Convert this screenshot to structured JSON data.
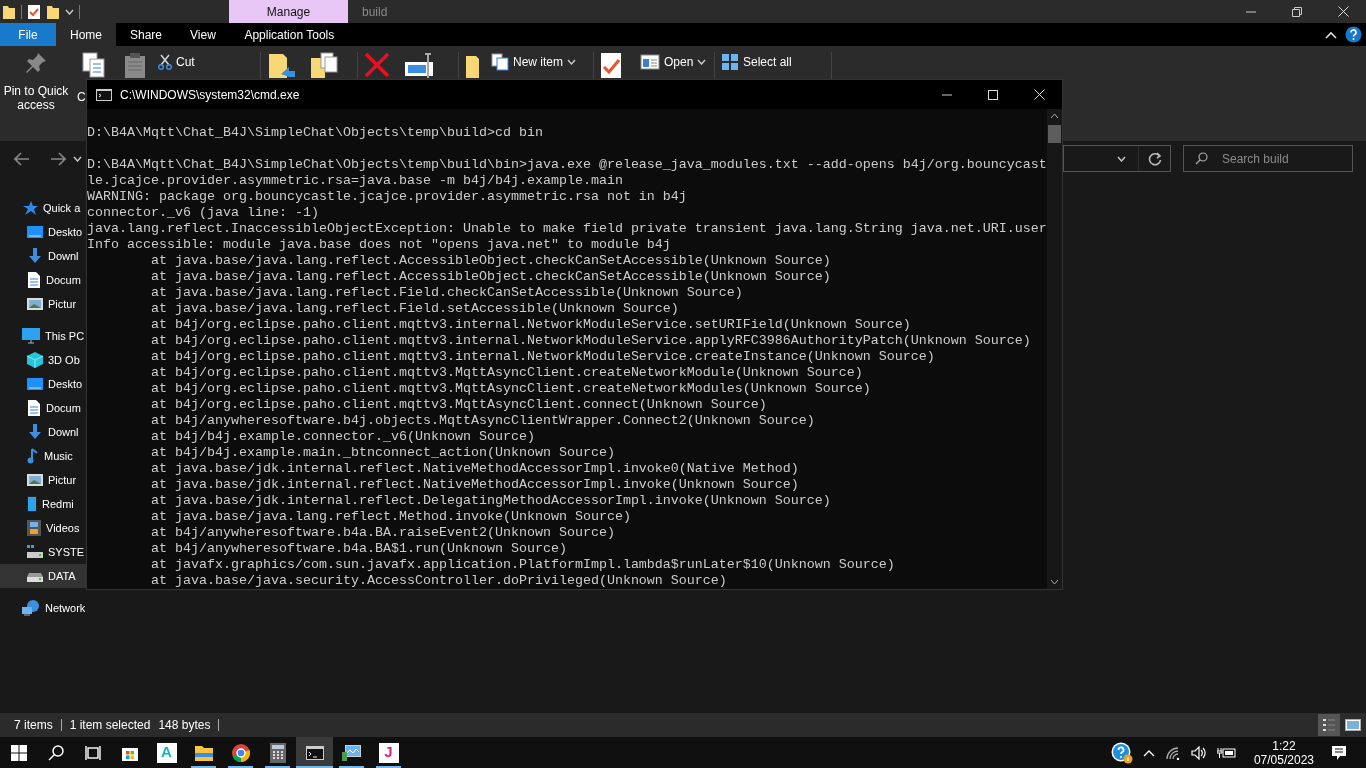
{
  "explorer": {
    "context_tab": "Manage",
    "title": "build",
    "tabs": [
      {
        "label": "File",
        "kind": "file",
        "selected": false
      },
      {
        "label": "Home",
        "kind": "tab",
        "selected": true
      },
      {
        "label": "Share",
        "kind": "tab",
        "selected": false
      },
      {
        "label": "View",
        "kind": "tab",
        "selected": false
      },
      {
        "label": "Application Tools",
        "kind": "context",
        "selected": false
      }
    ],
    "ribbon": [
      {
        "kind": "pin",
        "label": "Pin to Quick access"
      },
      {
        "kind": "copy",
        "label": "C"
      },
      {
        "kind": "paste"
      },
      {
        "kind": "cut",
        "label": "Cut"
      },
      {
        "kind": "separator"
      },
      {
        "kind": "move"
      },
      {
        "kind": "copyto"
      },
      {
        "kind": "separator"
      },
      {
        "kind": "delete"
      },
      {
        "kind": "rename"
      },
      {
        "kind": "separator"
      },
      {
        "kind": "newfolder"
      },
      {
        "kind": "newitem",
        "label": "New item"
      },
      {
        "kind": "separator"
      },
      {
        "kind": "properties"
      },
      {
        "kind": "open",
        "label": "Open"
      },
      {
        "kind": "separator"
      },
      {
        "kind": "selectall",
        "label": "Select all"
      },
      {
        "kind": "separator"
      }
    ],
    "search": {
      "placeholder": "Search build"
    },
    "sidebar": [
      {
        "label": "Quick a",
        "kind": "star",
        "selected": false,
        "children": [
          {
            "label": "Deskto",
            "kind": "desktop",
            "selected": false
          },
          {
            "label": "Downl",
            "kind": "download",
            "selected": false
          },
          {
            "label": "Docum",
            "kind": "document",
            "selected": false
          },
          {
            "label": "Pictur",
            "kind": "picture",
            "selected": false
          }
        ]
      },
      {
        "label": "This PC",
        "kind": "pc",
        "selected": false,
        "children": [
          {
            "label": "3D Ob",
            "kind": "cube",
            "selected": false
          },
          {
            "label": "Deskto",
            "kind": "desktop",
            "selected": false
          },
          {
            "label": "Docum",
            "kind": "document",
            "selected": false
          },
          {
            "label": "Downl",
            "kind": "download",
            "selected": false
          },
          {
            "label": "Music",
            "kind": "music",
            "selected": false
          },
          {
            "label": "Pictur",
            "kind": "picture",
            "selected": false
          },
          {
            "label": "Redmi",
            "kind": "phone",
            "selected": false
          },
          {
            "label": "Videos",
            "kind": "video",
            "selected": false
          },
          {
            "label": "SYSTE",
            "kind": "sysdrive",
            "selected": false
          },
          {
            "label": "DATA",
            "kind": "drive",
            "selected": true
          }
        ]
      },
      {
        "label": "Network",
        "kind": "network",
        "selected": false
      }
    ],
    "status_bar": [
      {
        "text": "7 items",
        "divider_after": true
      },
      {
        "text": "1 item selected",
        "divider_after": false
      },
      {
        "text": "148 bytes",
        "divider_after": true
      }
    ],
    "view_buttons": [
      {
        "kind": "details",
        "selected": true
      },
      {
        "kind": "thumbnails",
        "selected": false
      }
    ]
  },
  "console": {
    "title": "C:\\WINDOWS\\system32\\cmd.exe",
    "lines": [
      {
        "text": "D:\\B4A\\Mqtt\\Chat_B4J\\SimpleChat\\Objects\\temp\\build>cd bin"
      },
      {
        "text": "D:\\B4A\\Mqtt\\Chat_B4J\\SimpleChat\\Objects\\temp\\build\\bin>java.exe @release_java_modules.txt --add-opens b4j/org.bouncycast",
        "blank_before": true
      },
      {
        "text": "le.jcajce.provider.asymmetric.rsa=java.base -m b4j/b4j.example.main"
      },
      {
        "text": "WARNING: package org.bouncycastle.jcajce.provider.asymmetric.rsa not in b4j"
      },
      {
        "text": "connector._v6 (java line: -1)"
      },
      {
        "text": "java.lang.reflect.InaccessibleObjectException: Unable to make field private transient java.lang.String java.net.URI.user"
      },
      {
        "text": "Info accessible: module java.base does not \"opens java.net\" to module b4j"
      },
      {
        "text": "        at java.base/java.lang.reflect.AccessibleObject.checkCanSetAccessible(Unknown Source)"
      },
      {
        "text": "        at java.base/java.lang.reflect.AccessibleObject.checkCanSetAccessible(Unknown Source)"
      },
      {
        "text": "        at java.base/java.lang.reflect.Field.checkCanSetAccessible(Unknown Source)"
      },
      {
        "text": "        at java.base/java.lang.reflect.Field.setAccessible(Unknown Source)"
      },
      {
        "text": "        at b4j/org.eclipse.paho.client.mqttv3.internal.NetworkModuleService.setURIField(Unknown Source)"
      },
      {
        "text": "        at b4j/org.eclipse.paho.client.mqttv3.internal.NetworkModuleService.applyRFC3986AuthorityPatch(Unknown Source)"
      },
      {
        "text": "        at b4j/org.eclipse.paho.client.mqttv3.internal.NetworkModuleService.createInstance(Unknown Source)"
      },
      {
        "text": "        at b4j/org.eclipse.paho.client.mqttv3.MqttAsyncClient.createNetworkModule(Unknown Source)"
      },
      {
        "text": "        at b4j/org.eclipse.paho.client.mqttv3.MqttAsyncClient.createNetworkModules(Unknown Source)"
      },
      {
        "text": "        at b4j/org.eclipse.paho.client.mqttv3.MqttAsyncClient.connect(Unknown Source)"
      },
      {
        "text": "        at b4j/anywheresoftware.b4j.objects.MqttAsyncClientWrapper.Connect2(Unknown Source)"
      },
      {
        "text": "        at b4j/b4j.example.connector._v6(Unknown Source)"
      },
      {
        "text": "        at b4j/b4j.example.main._btnconnect_action(Unknown Source)"
      },
      {
        "text": "        at java.base/jdk.internal.reflect.NativeMethodAccessorImpl.invoke0(Native Method)"
      },
      {
        "text": "        at java.base/jdk.internal.reflect.NativeMethodAccessorImpl.invoke(Unknown Source)"
      },
      {
        "text": "        at java.base/jdk.internal.reflect.DelegatingMethodAccessorImpl.invoke(Unknown Source)"
      },
      {
        "text": "        at java.base/java.lang.reflect.Method.invoke(Unknown Source)"
      },
      {
        "text": "        at b4j/anywheresoftware.b4a.BA.raiseEvent2(Unknown Source)"
      },
      {
        "text": "        at b4j/anywheresoftware.b4a.BA$1.run(Unknown Source)"
      },
      {
        "text": "        at javafx.graphics/com.sun.javafx.application.PlatformImpl.lambda$runLater$10(Unknown Source)"
      },
      {
        "text": "        at java.base/java.security.AccessController.doPrivileged(Unknown Source)"
      }
    ]
  },
  "taskbar": {
    "apps": [
      {
        "kind": "store",
        "running": false,
        "active": false
      },
      {
        "kind": "font",
        "label": "A",
        "running": false,
        "active": false
      },
      {
        "kind": "explorer",
        "running": true,
        "active": false
      },
      {
        "kind": "chrome",
        "running": true,
        "active": false
      },
      {
        "kind": "calculator",
        "running": true,
        "active": false
      },
      {
        "kind": "cmd",
        "running": true,
        "active": true
      },
      {
        "kind": "monitor",
        "running": true,
        "active": false
      },
      {
        "kind": "jtile",
        "label": "J",
        "running": true,
        "active": false
      }
    ],
    "time": "1:22",
    "date": "07/05/2023"
  }
}
